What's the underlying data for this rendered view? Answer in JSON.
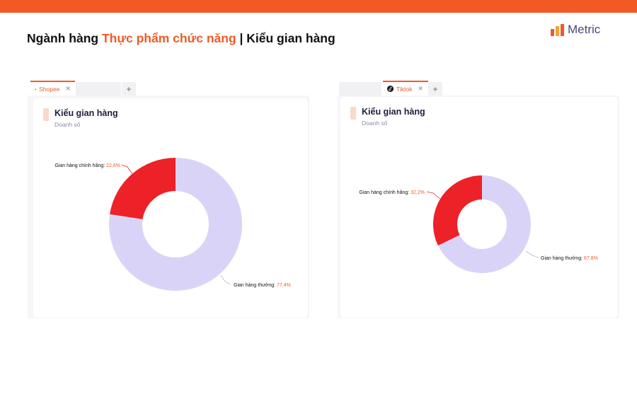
{
  "header": {
    "title_prefix": "Ngành hàng ",
    "title_accent": "Thực phẩm chức năng",
    "title_suffix": " | Kiểu gian hàng"
  },
  "brand": {
    "name": "Metric",
    "colors": {
      "accent": "#f15a24",
      "series_primary": "#ed2228",
      "series_secondary": "#d9d4f7"
    }
  },
  "panels": [
    {
      "tab_label": "Shopee",
      "card_title": "Kiểu gian hàng",
      "card_subtitle": "Doanh số"
    },
    {
      "tab_label": "Tiktok",
      "card_title": "Kiểu gian hàng",
      "card_subtitle": "Doanh số"
    }
  ],
  "chart_data": [
    {
      "type": "pie",
      "title": "Kiểu gian hàng",
      "subtitle": "Doanh số",
      "categories": [
        "Gian hàng chính hãng",
        "Gian hàng thường"
      ],
      "values": [
        22.6,
        77.4
      ],
      "value_labels": [
        "22,6%",
        "77,4%"
      ],
      "colors": [
        "#ed2228",
        "#d9d4f7"
      ],
      "donut": true
    },
    {
      "type": "pie",
      "title": "Kiểu gian hàng",
      "subtitle": "Doanh số",
      "categories": [
        "Gian hàng chính hãng",
        "Gian hàng thường"
      ],
      "values": [
        32.2,
        67.8
      ],
      "value_labels": [
        "32,2%",
        "67,8%"
      ],
      "colors": [
        "#ed2228",
        "#d9d4f7"
      ],
      "donut": true
    }
  ]
}
